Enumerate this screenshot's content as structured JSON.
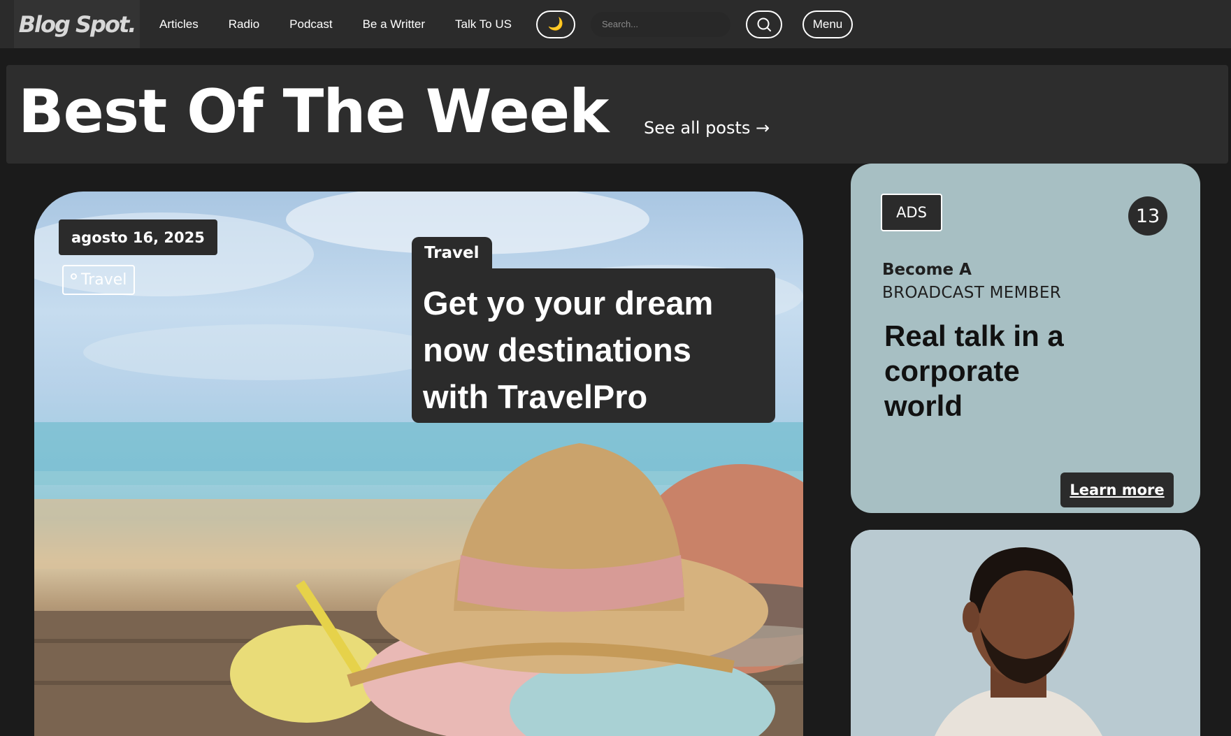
{
  "navbar": {
    "logo": "Blog Spot.",
    "links": [
      "Articles",
      "Radio",
      "Podcast",
      "Be a Writter",
      "Talk To US"
    ],
    "theme_toggle_icon": "moon-icon",
    "search_placeholder": "Search...",
    "search_icon": "search-icon",
    "menu_label": "Menu"
  },
  "hero": {
    "title": "Best Of The Week",
    "see_all": "See all posts →"
  },
  "feature": {
    "date": "agosto 16, 2025",
    "tag": "Travel",
    "category": "Travel",
    "headline": "Get yo your dream now destinations with TravelPro"
  },
  "ads": {
    "label": "ADS",
    "count": "13",
    "sub_line1": "Become A",
    "sub_line2": "BROADCAST MEMBER",
    "headline": "Real talk in a corporate world",
    "cta": "Learn more"
  },
  "colors": {
    "page_bg": "#1b1b1b",
    "navbar_bg": "#2b2b2b",
    "ads_card_bg": "#a7bfc3",
    "dark_badge": "#2b2b2b"
  }
}
